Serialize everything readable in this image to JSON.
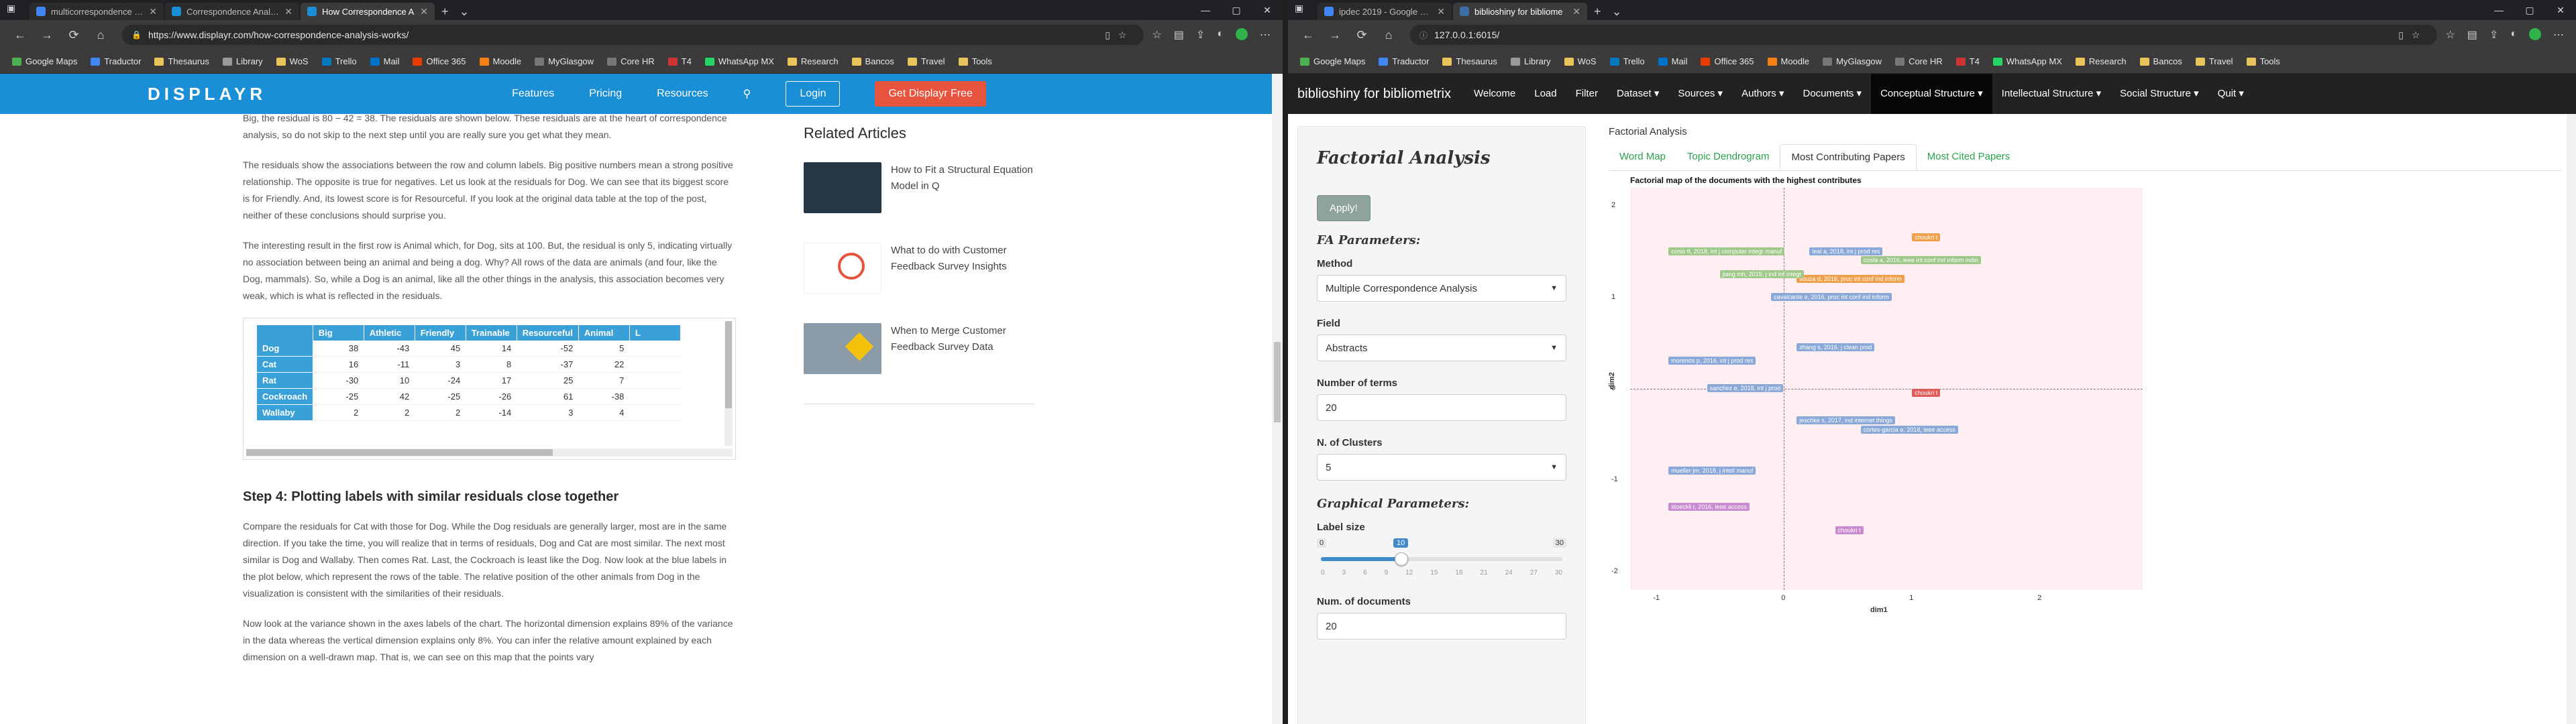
{
  "left_browser": {
    "tabs": [
      {
        "label": "multicorrespondence analysi",
        "active": false,
        "color": "#4285f4"
      },
      {
        "label": "Correspondence Analysis W",
        "active": false,
        "color": "#1a8fd6"
      },
      {
        "label": "How Correspondence A",
        "active": true,
        "color": "#1a8fd6"
      }
    ],
    "url": "https://www.displayr.com/how-correspondence-analysis-works/",
    "bookmarks": [
      "Google Maps",
      "Traductor",
      "Thesaurus",
      "Library",
      "WoS",
      "Trello",
      "Mail",
      "Office 365",
      "Moodle",
      "MyGlasgow",
      "Core HR",
      "T4",
      "WhatsApp MX",
      "Research",
      "Bancos",
      "Travel",
      "Tools"
    ]
  },
  "displayr": {
    "logo": "DISPLAYR",
    "nav": [
      "Features",
      "Pricing",
      "Resources"
    ],
    "login": "Login",
    "cta": "Get Displayr Free",
    "paragraphs_top": [
      "Big, the residual is 80 − 42 = 38. The residuals are shown below. These residuals are at the heart of correspondence analysis, so do not skip to the next step until you are really sure you get what they mean.",
      "The residuals show the associations between the row and column labels. Big positive numbers mean a strong positive relationship. The opposite is true for negatives. Let us look at the residuals for Dog. We can see that its biggest score is for Friendly. And, its lowest score is for Resourceful. If you look at the original data table at the top of the post, neither of these conclusions should surprise you.",
      "The interesting result in the first row is Animal which, for Dog, sits at 100. But, the residual is only 5, indicating virtually no association between being an animal and being a dog. Why? All rows of the data are animals (and four, like the Dog, mammals). So, while a Dog is an animal, like all the other things in the analysis, this association becomes very weak, which is what is reflected in the residuals."
    ],
    "table": {
      "columns": [
        "",
        "Big",
        "Athletic",
        "Friendly",
        "Trainable",
        "Resourceful",
        "Animal",
        "L"
      ],
      "rows": [
        {
          "label": "Dog",
          "values": [
            "38",
            "-43",
            "45",
            "14",
            "-52",
            "5"
          ]
        },
        {
          "label": "Cat",
          "values": [
            "16",
            "-11",
            "3",
            "8",
            "-37",
            "22"
          ]
        },
        {
          "label": "Rat",
          "values": [
            "-30",
            "10",
            "-24",
            "17",
            "25",
            "7"
          ]
        },
        {
          "label": "Cockroach",
          "values": [
            "-25",
            "42",
            "-25",
            "-26",
            "61",
            "-38"
          ]
        },
        {
          "label": "Wallaby",
          "values": [
            "2",
            "2",
            "2",
            "-14",
            "3",
            "4"
          ]
        }
      ]
    },
    "heading_step4": "Step 4: Plotting labels with similar residuals close together",
    "paragraphs_bottom": [
      "Compare the residuals for Cat with those for Dog. While the Dog residuals are generally larger, most are in the same direction. If you take the time, you will realize that in terms of residuals, Dog and Cat are most similar. The next most similar is Dog and Wallaby. Then comes Rat. Last, the Cockroach is least like the Dog. Now look at the blue labels in the plot below, which represent the rows of the table. The relative position of the other animals from Dog in the visualization is consistent with the similarities of their residuals.",
      "Now look at the variance shown in the axes labels of the chart. The horizontal dimension explains 89% of the variance in the data whereas the vertical dimension explains only 8%. You can infer the relative amount explained by each dimension on a well-drawn map. That is, we can see on this map that the points vary"
    ],
    "related_title": "Related Articles",
    "related": [
      "How to Fit a Structural Equation Model in Q",
      "What to do with Customer Feedback Survey Insights",
      "When to Merge Customer Feedback Survey Data"
    ]
  },
  "right_browser": {
    "tabs": [
      {
        "label": "ipdec 2019 - Google Searcl",
        "active": false,
        "color": "#4285f4"
      },
      {
        "label": "biblioshiny for bibliome",
        "active": true,
        "color": "#3a6ea5"
      }
    ],
    "url": "127.0.0.1:6015/",
    "bookmarks": [
      "Google Maps",
      "Traductor",
      "Thesaurus",
      "Library",
      "WoS",
      "Trello",
      "Mail",
      "Office 365",
      "Moodle",
      "MyGlasgow",
      "Core HR",
      "T4",
      "WhatsApp MX",
      "Research",
      "Bancos",
      "Travel",
      "Tools"
    ]
  },
  "biblioshiny": {
    "brand": "biblioshiny for bibliometrix",
    "nav": [
      "Welcome",
      "Load",
      "Filter",
      "Dataset ▾",
      "Sources ▾",
      "Authors ▾",
      "Documents ▾",
      "Conceptual Structure ▾",
      "Intellectual Structure ▾",
      "Social Structure ▾",
      "Quit ▾"
    ],
    "sidebar": {
      "title": "Factorial Analysis",
      "apply": "Apply!",
      "fa_params": "FA Parameters:",
      "method_label": "Method",
      "method_value": "Multiple Correspondence Analysis",
      "field_label": "Field",
      "field_value": "Abstracts",
      "terms_label": "Number of terms",
      "terms_value": "20",
      "clusters_label": "N. of Clusters",
      "clusters_value": "5",
      "graph_params": "Graphical Parameters:",
      "labelsize_label": "Label size",
      "labelsize_min": "0",
      "labelsize_value": "10",
      "labelsize_max": "30",
      "labelsize_ticks": [
        "0",
        "3",
        "6",
        "9",
        "12",
        "15",
        "18",
        "21",
        "24",
        "27",
        "30"
      ],
      "docs_label": "Num. of documents",
      "docs_value": "20"
    },
    "breadcrumb": "Factorial Analysis",
    "subtabs": [
      "Word Map",
      "Topic Dendrogram",
      "Most Contributing Papers",
      "Most Cited Papers"
    ],
    "plot": {
      "title": "Factorial map of the documents with the highest contributes",
      "xlabel": "dim1",
      "ylabel": "dim2",
      "x_ticks": [
        "-1",
        "0",
        "1",
        "2"
      ],
      "y_ticks": [
        "2",
        "1",
        "0",
        "-1",
        "-2"
      ],
      "labels": [
        {
          "text": "choukri t",
          "color": "#f0a04b",
          "x": 1.0,
          "y": 1.7
        },
        {
          "text": "cosio ft, 2018, int j computer integr manuf",
          "color": "#9ec98a",
          "x": -0.9,
          "y": 1.55
        },
        {
          "text": "leal a, 2018, int j prod res",
          "color": "#8aa8d8",
          "x": 0.2,
          "y": 1.55
        },
        {
          "text": "costa a, 2016, ieee int conf ind inform indin",
          "color": "#9ec98a",
          "x": 0.6,
          "y": 1.45
        },
        {
          "text": "souza d, 2016, proc int conf ind inform",
          "color": "#f0a04b",
          "x": 0.1,
          "y": 1.25
        },
        {
          "text": "jiang mh, 2019, j ind inf integr",
          "color": "#9ec98a",
          "x": -0.5,
          "y": 1.3
        },
        {
          "text": "cavalcante e, 2016, proc int conf ind inform",
          "color": "#8aa8d8",
          "x": -0.1,
          "y": 1.05
        },
        {
          "text": "zhang s, 2016, j clean prod",
          "color": "#8aa8d8",
          "x": 0.1,
          "y": 0.5
        },
        {
          "text": "morenos p, 2016, int j prod res",
          "color": "#8aa8d8",
          "x": -0.9,
          "y": 0.35
        },
        {
          "text": "sanchez e, 2018, int j prod",
          "color": "#8aa8d8",
          "x": -0.6,
          "y": 0.05
        },
        {
          "text": "choukri t",
          "color": "#e05a5a",
          "x": 1.0,
          "y": 0.0
        },
        {
          "text": "jeschke s, 2017, ind internet things",
          "color": "#8aa8d8",
          "x": 0.1,
          "y": -0.3
        },
        {
          "text": "cortes-garcia e, 2018, ieee access",
          "color": "#8aa8d8",
          "x": 0.6,
          "y": -0.4
        },
        {
          "text": "mueller jm, 2018, j intell manuf",
          "color": "#8aa8d8",
          "x": -0.9,
          "y": -0.85
        },
        {
          "text": "stoeckli r, 2016, ieee access",
          "color": "#c88ad0",
          "x": -0.9,
          "y": -1.25
        },
        {
          "text": "choukri t",
          "color": "#c88ad0",
          "x": 0.4,
          "y": -1.5
        }
      ]
    }
  }
}
